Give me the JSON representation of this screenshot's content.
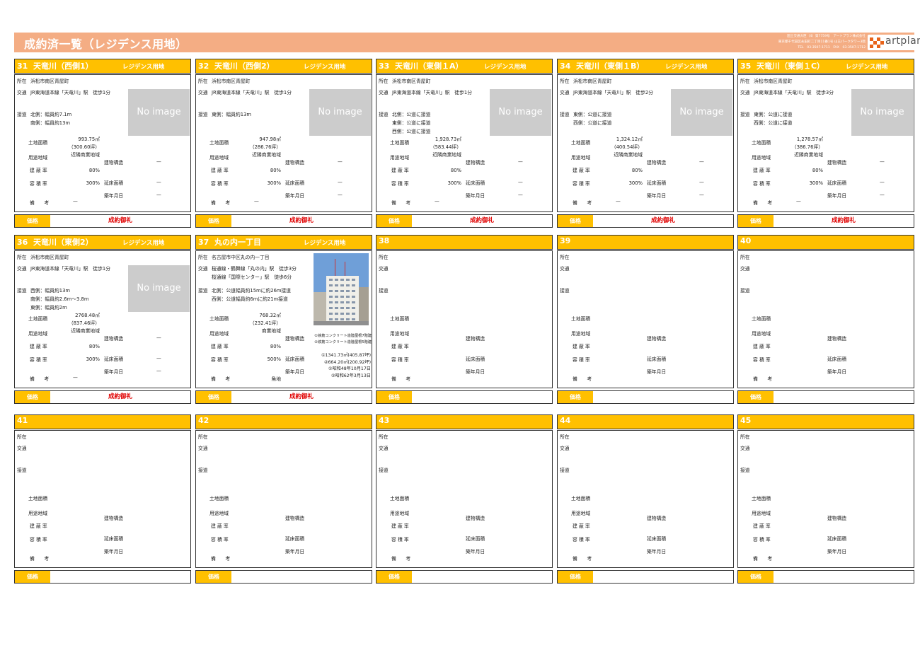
{
  "banner": {
    "title": "成約済一覧（レジデンス用地）",
    "company_lines": [
      "国土交通大臣（4）第7759号　アートプラン株式会社",
      "東京都千代田区永田町二丁目11番1号 山王パークタワー3階",
      "TEL　03-3507-1711　FAX　03-3507-1712"
    ],
    "logo_text": "artplan",
    "colors": {
      "banner": "#f4ad84",
      "header": "#ffc000",
      "sold": "#e00000",
      "logo_mark": "#e8631a"
    }
  },
  "labels": {
    "location": "所在",
    "transport": "交通",
    "road": "接道",
    "land_area": "土地面積",
    "zoning": "用途地域",
    "coverage": "建 蔽 率",
    "far": "容 積 率",
    "remarks": "備　　考",
    "structure": "建物構造",
    "floor_area": "延床面積",
    "built": "築年月日",
    "price": "価格",
    "no_image": "No image"
  },
  "cards": [
    {
      "num": "31",
      "name": "天竜川（西側1）",
      "category": "レジデンス用地",
      "location": "浜松市南区青屋町",
      "transport": [
        "JR東海道本線「天竜川」駅　徒歩1分"
      ],
      "road": [
        "北側：幅員約7.1m",
        "南側：幅員約13m"
      ],
      "land_area": "993.75㎡",
      "land_area_tsubo": "（300.60坪）",
      "zoning": "近隣商業地域",
      "coverage": "80%",
      "far": "300%",
      "remarks": "—",
      "structure": "—",
      "floor_area": "—",
      "built": "—",
      "price": "成約御礼",
      "image": "none"
    },
    {
      "num": "32",
      "name": "天竜川（西側2）",
      "category": "レジデンス用地",
      "location": "浜松市南区青屋町",
      "transport": [
        "JR東海道本線「天竜川」駅　徒歩1分"
      ],
      "road": [
        "東側：幅員約13m"
      ],
      "land_area": "947.98㎡",
      "land_area_tsubo": "（286.76坪）",
      "zoning": "近隣商業地域",
      "coverage": "80%",
      "far": "300%",
      "remarks": "—",
      "structure": "—",
      "floor_area": "—",
      "built": "—",
      "price": "成約御礼",
      "image": "none"
    },
    {
      "num": "33",
      "name": "天竜川（東側１A）",
      "category": "レジデンス用地",
      "location": "浜松市南区青屋町",
      "transport": [
        "JR東海道本線「天竜川」駅　徒歩1分"
      ],
      "road": [
        "北側：公道に接道",
        "東側：公道に接道",
        "西側：公道に接道"
      ],
      "land_area": "1,928.73㎡",
      "land_area_tsubo": "（583.44坪）",
      "zoning": "近隣商業地域",
      "coverage": "80%",
      "far": "300%",
      "remarks": "—",
      "structure": "—",
      "floor_area": "—",
      "built": "—",
      "price": "成約御礼",
      "image": "none"
    },
    {
      "num": "34",
      "name": "天竜川（東側１B）",
      "category": "レジデンス用地",
      "location": "浜松市南区青屋町",
      "transport": [
        "JR東海道本線「天竜川」駅　徒歩2分"
      ],
      "road": [
        "東側：公道に接道",
        "西側：公道に接道"
      ],
      "land_area": "1,324.12㎡",
      "land_area_tsubo": "（400.54坪）",
      "zoning": "近隣商業地域",
      "coverage": "80%",
      "far": "300%",
      "remarks": "—",
      "structure": "—",
      "floor_area": "—",
      "built": "—",
      "price": "成約御礼",
      "image": "none"
    },
    {
      "num": "35",
      "name": "天竜川（東側１C）",
      "category": "レジデンス用地",
      "location": "浜松市南区青屋町",
      "transport": [
        "JR東海道本線「天竜川」駅　徒歩3分"
      ],
      "road": [
        "東側：公道に接道",
        "西側：公道に接道"
      ],
      "land_area": "1,278.57㎡",
      "land_area_tsubo": "（386.76坪）",
      "zoning": "近隣商業地域",
      "coverage": "80%",
      "far": "300%",
      "remarks": "—",
      "structure": "—",
      "floor_area": "—",
      "built": "—",
      "price": "成約御礼",
      "image": "none"
    },
    {
      "num": "36",
      "name": "天竜川（東側2）",
      "category": "レジデンス用地",
      "location": "浜松市南区青屋町",
      "transport": [
        "JR東海道本線「天竜川」駅　徒歩1分"
      ],
      "road": [
        "西側：幅員約13m",
        "南側：幅員約2.6m～3.8m",
        "東側：幅員約2m"
      ],
      "land_area": "2768.48㎡",
      "land_area_tsubo": "（837.46坪）",
      "zoning": "近隣商業地域",
      "coverage": "80%",
      "far": "300%",
      "remarks": "—",
      "structure": "—",
      "floor_area": "—",
      "built": "—",
      "price": "成約御礼",
      "image": "none"
    },
    {
      "num": "37",
      "name": "丸の内一丁目",
      "category": "レジデンス用地",
      "location": "名古屋市中区丸の内一丁目",
      "transport": [
        "桜通線・鶴舞線「丸の内」駅　徒歩3分",
        "桜通線「国際センター」駅　徒歩6分"
      ],
      "road": [
        "北側：公道幅員約15mに約26m接道",
        "西側：公道幅員約6mに約21m接道"
      ],
      "land_area": "768.32㎡",
      "land_area_tsubo": "（232.41坪）",
      "zoning": "商業地域",
      "coverage": "80%",
      "far": "500%",
      "remarks": "角地",
      "structure_lines": [
        "①鉄筋コンクリート造陸屋根7階建",
        "②鉄筋コンクリート造陸屋根5階建"
      ],
      "floor_area_lines": [
        "①1341.73㎡(405.87坪)",
        "②664.20㎡(200.92坪)"
      ],
      "built_lines": [
        "①昭和48年10月17日",
        "②昭和62年3月13日"
      ],
      "price": "成約御礼",
      "image": "photo"
    },
    {
      "num": "38",
      "price": ""
    },
    {
      "num": "39",
      "price": ""
    },
    {
      "num": "40",
      "price": ""
    },
    {
      "num": "41",
      "price": ""
    },
    {
      "num": "42",
      "price": ""
    },
    {
      "num": "43",
      "price": ""
    },
    {
      "num": "44",
      "price": ""
    },
    {
      "num": "45",
      "price": ""
    }
  ]
}
